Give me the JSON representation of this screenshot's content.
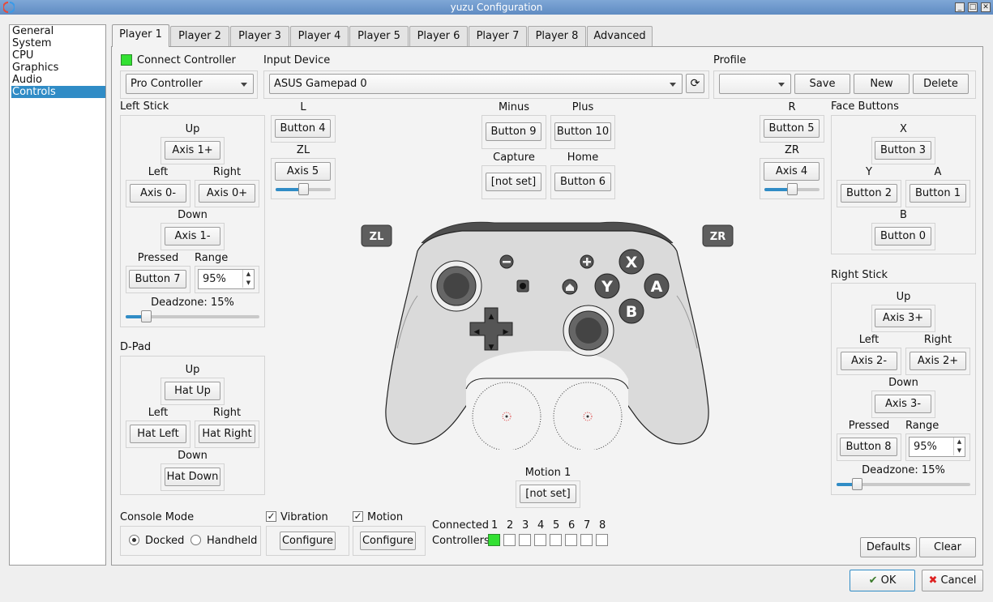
{
  "window": {
    "title": "yuzu Configuration"
  },
  "sidebar": {
    "items": [
      "General",
      "System",
      "CPU",
      "Graphics",
      "Audio",
      "Controls"
    ],
    "selected": "Controls"
  },
  "tabs": [
    "Player 1",
    "Player 2",
    "Player 3",
    "Player 4",
    "Player 5",
    "Player 6",
    "Player 7",
    "Player 8",
    "Advanced"
  ],
  "player": {
    "connect_label": "Connect Controller",
    "connected_color": "#33e133",
    "controller_type": "Pro Controller",
    "input_device_label": "Input Device",
    "input_device": "ASUS Gamepad 0",
    "profile_label": "Profile",
    "profile_value": "",
    "save": "Save",
    "new": "New",
    "delete": "Delete"
  },
  "left_stick": {
    "title": "Left Stick",
    "up_label": "Up",
    "up": "Axis 1+",
    "left_label": "Left",
    "left": "Axis 0-",
    "right_label": "Right",
    "right": "Axis 0+",
    "down_label": "Down",
    "down": "Axis 1-",
    "pressed_label": "Pressed",
    "pressed": "Button 7",
    "range_label": "Range",
    "range": "95%",
    "deadzone": "Deadzone: 15%",
    "deadzone_value": 0.15
  },
  "dpad": {
    "title": "D-Pad",
    "up_label": "Up",
    "up": "Hat Up",
    "left_label": "Left",
    "left": "Hat Left",
    "right_label": "Right",
    "right": "Hat Right",
    "down_label": "Down",
    "down": "Hat Down"
  },
  "shoulders": {
    "l_label": "L",
    "l": "Button 4",
    "zl_label": "ZL",
    "zl": "Axis 5",
    "zl_threshold": 0.5,
    "r_label": "R",
    "r": "Button 5",
    "zr_label": "ZR",
    "zr": "Axis 4",
    "zr_threshold": 0.5
  },
  "misc": {
    "minus_label": "Minus",
    "minus": "Button 9",
    "plus_label": "Plus",
    "plus": "Button 10",
    "capture_label": "Capture",
    "capture": "[not set]",
    "home_label": "Home",
    "home": "Button 6"
  },
  "face": {
    "title": "Face Buttons",
    "x_label": "X",
    "x": "Button 3",
    "y_label": "Y",
    "y": "Button 2",
    "a_label": "A",
    "a": "Button 1",
    "b_label": "B",
    "b": "Button 0"
  },
  "right_stick": {
    "title": "Right Stick",
    "up_label": "Up",
    "up": "Axis 3+",
    "left_label": "Left",
    "left": "Axis 2-",
    "right_label": "Right",
    "right": "Axis 2+",
    "down_label": "Down",
    "down": "Axis 3-",
    "pressed_label": "Pressed",
    "pressed": "Button 8",
    "range_label": "Range",
    "range": "95%",
    "deadzone": "Deadzone: 15%",
    "deadzone_value": 0.15
  },
  "graphic": {
    "zl": "ZL",
    "zr": "ZR",
    "x": "X",
    "y": "Y",
    "a": "A",
    "b": "B"
  },
  "motion": {
    "label": "Motion 1",
    "value": "[not set]"
  },
  "console": {
    "title": "Console Mode",
    "docked": "Docked",
    "handheld": "Handheld",
    "selected": "Docked"
  },
  "vibration": {
    "label": "Vibration",
    "checked": true,
    "configure": "Configure"
  },
  "motion_opt": {
    "label": "Motion",
    "checked": true,
    "configure": "Configure"
  },
  "connected": {
    "label1": "Connected",
    "label2": "Controllers",
    "numbers": [
      "1",
      "2",
      "3",
      "4",
      "5",
      "6",
      "7",
      "8"
    ],
    "states": [
      true,
      false,
      false,
      false,
      false,
      false,
      false,
      false
    ]
  },
  "footer": {
    "defaults": "Defaults",
    "clear": "Clear",
    "ok": "OK",
    "cancel": "Cancel"
  }
}
